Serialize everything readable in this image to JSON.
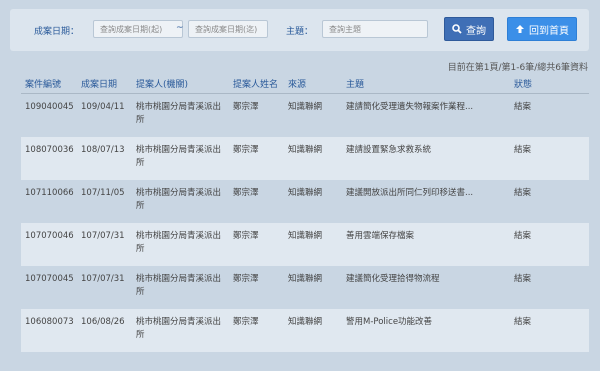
{
  "search": {
    "date_label": "成案日期：",
    "date_from_placeholder": "查詢成案日期(起)",
    "date_sep": "~",
    "date_to_placeholder": "查詢成案日期(迄)",
    "topic_label": "主題：",
    "topic_placeholder": "查詢主題",
    "search_button": "查詢",
    "home_button": "回到首頁"
  },
  "summary": "目前在第1頁/第1-6筆/總共6筆資料",
  "table": {
    "headers": [
      "案件編號",
      "成案日期",
      "提案人(機關)",
      "提案人姓名",
      "來源",
      "主題",
      "狀態"
    ],
    "rows": [
      {
        "id": "109040045",
        "date": "109/04/11",
        "unit": "桃市桃園分局青溪派出所",
        "name": "鄭宗澤",
        "source": "知識聯網",
        "topic": "建請簡化受理遺失物報案作業程...",
        "status": "結案"
      },
      {
        "id": "108070036",
        "date": "108/07/13",
        "unit": "桃市桃園分局青溪派出所",
        "name": "鄭宗澤",
        "source": "知識聯網",
        "topic": "建請設置緊急求救系統",
        "status": "結案"
      },
      {
        "id": "107110066",
        "date": "107/11/05",
        "unit": "桃市桃園分局青溪派出所",
        "name": "鄭宗澤",
        "source": "知識聯網",
        "topic": "建議開放派出所同仁列印移送書...",
        "status": "結案"
      },
      {
        "id": "107070046",
        "date": "107/07/31",
        "unit": "桃市桃園分局青溪派出所",
        "name": "鄭宗澤",
        "source": "知識聯網",
        "topic": "善用雲端保存檔案",
        "status": "結案"
      },
      {
        "id": "107070045",
        "date": "107/07/31",
        "unit": "桃市桃園分局青溪派出所",
        "name": "鄭宗澤",
        "source": "知識聯網",
        "topic": "建議簡化受理拾得物流程",
        "status": "結案"
      },
      {
        "id": "106080073",
        "date": "106/08/26",
        "unit": "桃市桃園分局青溪派出所",
        "name": "鄭宗澤",
        "source": "知識聯網",
        "topic": "警用M-Police功能改善",
        "status": "結案"
      }
    ]
  }
}
